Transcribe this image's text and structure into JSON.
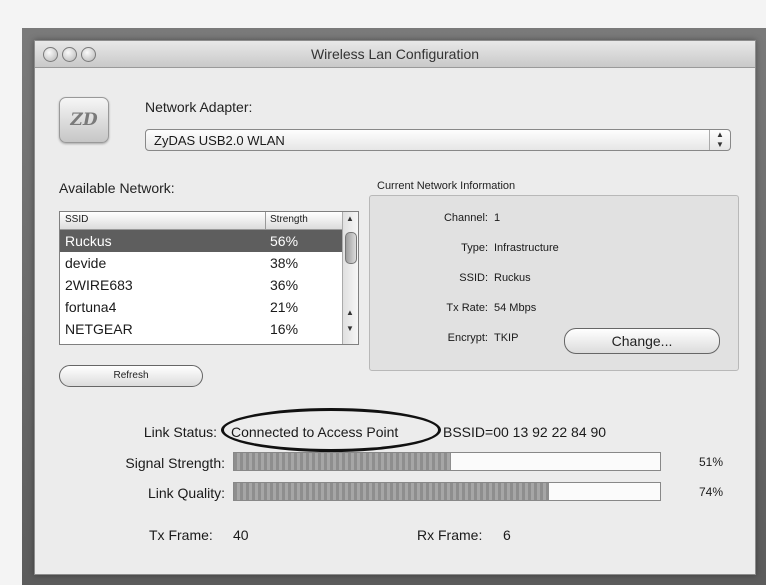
{
  "window": {
    "title": "Wireless Lan Configuration"
  },
  "logo": {
    "text": "ZD"
  },
  "adapter": {
    "label": "Network Adapter:",
    "selected": "ZyDAS USB2.0 WLAN"
  },
  "networks": {
    "label": "Available Network:",
    "columns": [
      "SSID",
      "Strength"
    ],
    "rows": [
      {
        "ssid": "Ruckus",
        "strength": "56%",
        "selected": true
      },
      {
        "ssid": "devide",
        "strength": "38%",
        "selected": false
      },
      {
        "ssid": "2WIRE683",
        "strength": "36%",
        "selected": false
      },
      {
        "ssid": "fortuna4",
        "strength": "21%",
        "selected": false
      },
      {
        "ssid": "NETGEAR",
        "strength": "16%",
        "selected": false
      }
    ],
    "refresh_label": "Refresh"
  },
  "current_info": {
    "title": "Current Network Information",
    "channel_label": "Channel:",
    "channel": "1",
    "type_label": "Type:",
    "type": "Infrastructure",
    "ssid_label": "SSID:",
    "ssid": "Ruckus",
    "txrate_label": "Tx Rate:",
    "txrate": "54 Mbps",
    "encrypt_label": "Encrypt:",
    "encrypt": "TKIP",
    "change_label": "Change..."
  },
  "link": {
    "status_label": "Link Status:",
    "status": "Connected to Access Point",
    "bssid": "BSSID=00 13 92 22 84 90",
    "signal_label": "Signal Strength:",
    "signal_value": "51%",
    "signal_fraction": 0.51,
    "quality_label": "Link Quality:",
    "quality_value": "74%",
    "quality_fraction": 0.74
  },
  "frames": {
    "tx_label": "Tx Frame:",
    "tx": "40",
    "rx_label": "Rx Frame:",
    "rx": "6"
  }
}
